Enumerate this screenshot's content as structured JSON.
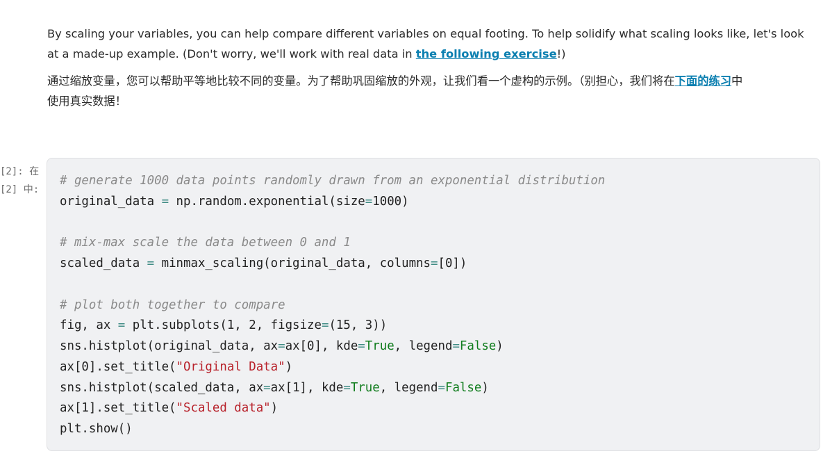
{
  "markdown": {
    "en_line1": "By scaling your variables, you can help compare different variables on equal footing. To help solidify what scaling looks like, let's look",
    "en_line2_prefix": "at a made-up example. (Don't worry, we'll work with real data in ",
    "en_link": "the following exercise",
    "en_suffix": "!)",
    "zh_line1_prefix": "通过缩放变量，您可以帮助平等地比较不同的变量。为了帮助巩固缩放的外观，让我们看一个虚构的示例。（别担心，我们将在",
    "zh_link": "下面的练习",
    "zh_line1_suffix": "中",
    "zh_line2": "使用真实数据！"
  },
  "cell": {
    "prompt_line1": "[2]: 在",
    "prompt_line2": "[2] 中:",
    "code": [
      [
        [
          "# generate 1000 data points randomly drawn from an exponential distribution",
          "c"
        ]
      ],
      [
        [
          "original_data ",
          ""
        ],
        [
          "=",
          "o"
        ],
        [
          " np.random.exponential(size",
          ""
        ],
        [
          "=",
          "o"
        ],
        [
          "1000)",
          ""
        ]
      ],
      [],
      [
        [
          "# mix-max scale the data between 0 and 1",
          "c"
        ]
      ],
      [
        [
          "scaled_data ",
          ""
        ],
        [
          "=",
          "o"
        ],
        [
          " minmax_scaling(original_data, columns",
          ""
        ],
        [
          "=",
          "o"
        ],
        [
          "[0])",
          ""
        ]
      ],
      [],
      [
        [
          "# plot both together to compare",
          "c"
        ]
      ],
      [
        [
          "fig, ax ",
          ""
        ],
        [
          "=",
          "o"
        ],
        [
          " plt.subplots(1, 2, figsize",
          ""
        ],
        [
          "=",
          "o"
        ],
        [
          "(15, 3))",
          ""
        ]
      ],
      [
        [
          "sns.histplot(original_data, ax",
          ""
        ],
        [
          "=",
          "o"
        ],
        [
          "ax[0], kde",
          ""
        ],
        [
          "=",
          "o"
        ],
        [
          "True",
          "k"
        ],
        [
          ", legend",
          ""
        ],
        [
          "=",
          "o"
        ],
        [
          "False",
          "k"
        ],
        [
          ")",
          ""
        ]
      ],
      [
        [
          "ax[0].set_title(",
          ""
        ],
        [
          "\"Original Data\"",
          "s"
        ],
        [
          ")",
          ""
        ]
      ],
      [
        [
          "sns.histplot(scaled_data, ax",
          ""
        ],
        [
          "=",
          "o"
        ],
        [
          "ax[1], kde",
          ""
        ],
        [
          "=",
          "o"
        ],
        [
          "True",
          "k"
        ],
        [
          ", legend",
          ""
        ],
        [
          "=",
          "o"
        ],
        [
          "False",
          "k"
        ],
        [
          ")",
          ""
        ]
      ],
      [
        [
          "ax[1].set_title(",
          ""
        ],
        [
          "\"Scaled data\"",
          "s"
        ],
        [
          ")",
          ""
        ]
      ],
      [
        [
          "plt.show()",
          ""
        ]
      ]
    ]
  }
}
